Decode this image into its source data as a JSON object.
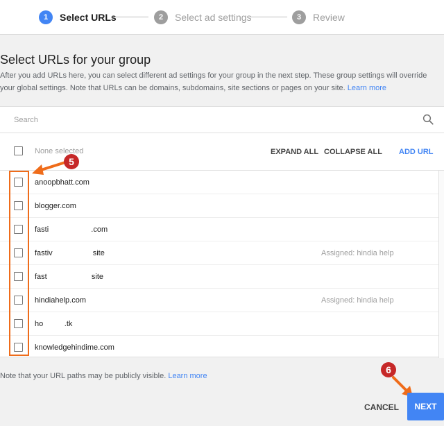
{
  "stepper": {
    "steps": [
      {
        "number": "1",
        "label": "Select URLs",
        "state": "active"
      },
      {
        "number": "2",
        "label": "Select ad settings",
        "state": "inactive"
      },
      {
        "number": "3",
        "label": "Review",
        "state": "inactive"
      }
    ]
  },
  "page": {
    "title": "Select URLs for your group",
    "description": "After you add URLs here, you can select different ad settings for your group in the next step. These group settings will override your global settings. Note that URLs can be domains, subdomains, site sections or pages on your site.",
    "learn_more": "Learn more"
  },
  "search": {
    "placeholder": "Search",
    "icon": "search-icon"
  },
  "toolbar": {
    "selection_status": "None selected",
    "expand_all": "EXPAND ALL",
    "collapse_all": "COLLAPSE ALL",
    "add_url": "ADD URL"
  },
  "urls": [
    {
      "url": "anoopbhatt.com",
      "assigned": ""
    },
    {
      "url": "blogger.com",
      "assigned": ""
    },
    {
      "url": "fasti                    .com",
      "assigned": ""
    },
    {
      "url": "fastiv                   site",
      "assigned": "Assigned: hindia help"
    },
    {
      "url": "fast                     site",
      "assigned": ""
    },
    {
      "url": "hindiahelp.com",
      "assigned": "Assigned: hindia help"
    },
    {
      "url": "ho          .tk",
      "assigned": ""
    },
    {
      "url": "knowledgehindime.com",
      "assigned": ""
    }
  ],
  "annotations": {
    "callout_5": "5",
    "callout_6": "6",
    "color": "#ef6c1a"
  },
  "footer": {
    "note": "Note that your URL paths may be publicly visible.",
    "learn_more": "Learn more",
    "cancel": "CANCEL",
    "next": "NEXT"
  },
  "colors": {
    "accent": "#4285f4",
    "callout": "#c62828",
    "arrow": "#ef6c1a"
  }
}
